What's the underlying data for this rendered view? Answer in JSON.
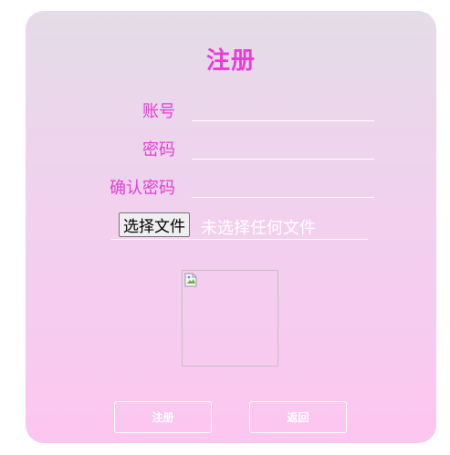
{
  "form": {
    "title": "注册",
    "account_label": "账号",
    "account_value": "",
    "password_label": "密码",
    "password_value": "",
    "confirm_label": "确认密码",
    "confirm_value": "",
    "file_button_label": "选择文件",
    "file_status": "未选择任何文件",
    "preview_icon": "broken-image-icon",
    "register_label": "注册",
    "back_label": "返回"
  },
  "colors": {
    "accent": "#e23fd0",
    "gradient_top": "#e4dce8",
    "gradient_bottom": "#fcc6f1",
    "button_text": "#ffffff"
  }
}
